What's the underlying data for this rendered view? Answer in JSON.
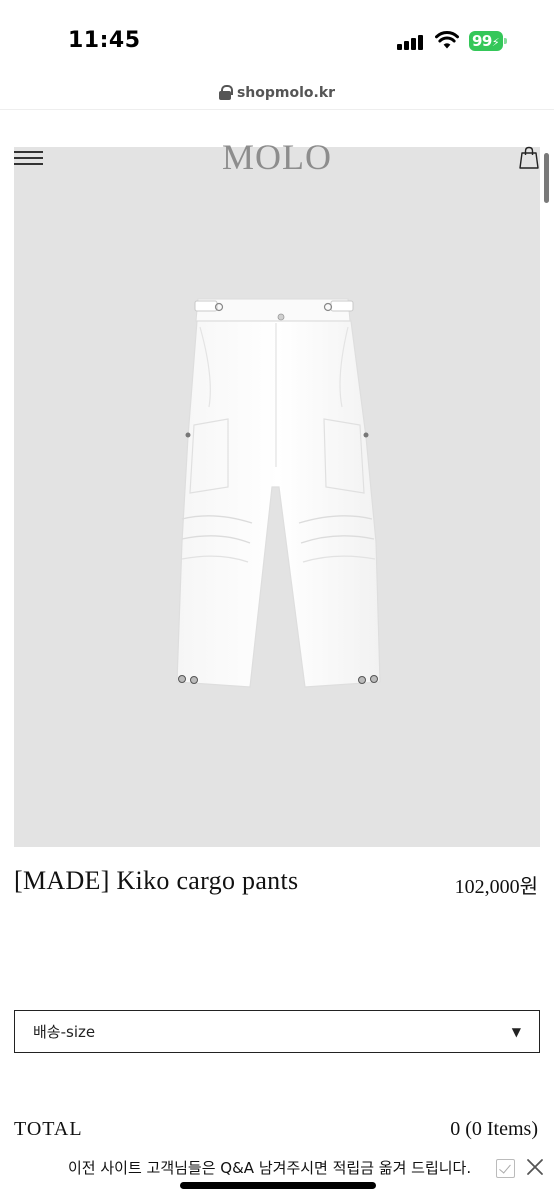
{
  "status_bar": {
    "time": "11:45",
    "battery_level": "99",
    "battery_color": "#34c759",
    "icons": [
      "signal-icon",
      "wifi-icon",
      "battery-icon"
    ]
  },
  "browser": {
    "url": "shopmolo.kr",
    "icons": [
      "lock-icon"
    ]
  },
  "header": {
    "logo": "MOLO",
    "icons": [
      "hamburger-menu-icon",
      "shopping-bag-icon"
    ]
  },
  "product": {
    "image_subject": "white-cargo-pants",
    "name": "[MADE] Kiko cargo pants",
    "price": "102,000원",
    "option_select": {
      "selected": "배송-size"
    },
    "total_label": "TOTAL",
    "total_value": "0 (0 Items)"
  },
  "notice": {
    "text": "이전 사이트 고객님들은 Q&A 남겨주시면 적립금 옮겨 드립니다.",
    "icons": [
      "checkbox-icon",
      "close-icon"
    ]
  },
  "colors": {
    "image_background": "#e3e3e3",
    "logo": "#8d8d8d"
  }
}
